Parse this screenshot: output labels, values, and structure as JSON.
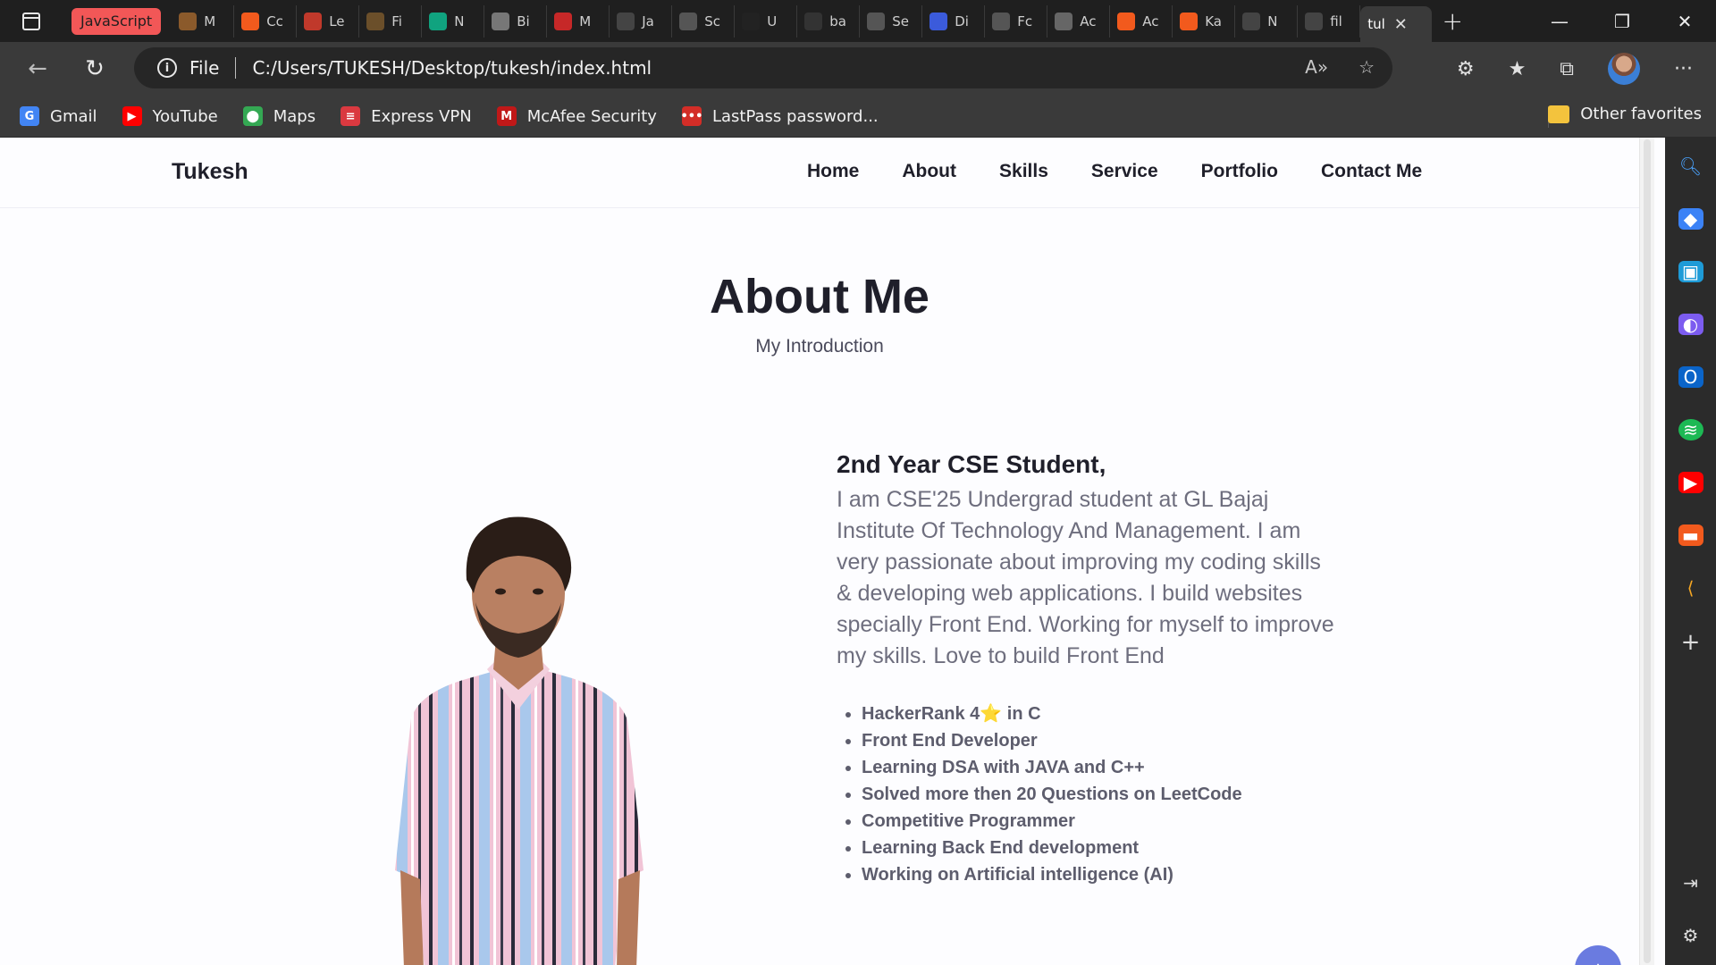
{
  "browser": {
    "group_label": "JavaScript",
    "tabs": [
      {
        "label": "M",
        "color": "#8b5a2b"
      },
      {
        "label": "Cc",
        "color": "#f25a1d"
      },
      {
        "label": "Le",
        "color": "#c0392b"
      },
      {
        "label": "Fi",
        "color": "#6b4f2a"
      },
      {
        "label": "N",
        "color": "#10a37f"
      },
      {
        "label": "Bi",
        "color": "#777777"
      },
      {
        "label": "M",
        "color": "#c62828"
      },
      {
        "label": "Ja",
        "color": "#444444"
      },
      {
        "label": "Sc",
        "color": "#555555"
      },
      {
        "label": "U",
        "color": "#222222"
      },
      {
        "label": "ba",
        "color": "#333333"
      },
      {
        "label": "Se",
        "color": "#555555"
      },
      {
        "label": "Di",
        "color": "#3b5bdb"
      },
      {
        "label": "Fc",
        "color": "#555555"
      },
      {
        "label": "Ac",
        "color": "#666666"
      },
      {
        "label": "Ac",
        "color": "#f25a1d"
      },
      {
        "label": "Ka",
        "color": "#f25a1d"
      },
      {
        "label": "N",
        "color": "#444444"
      },
      {
        "label": "fil",
        "color": "#444444"
      }
    ],
    "active_tab": "tul",
    "address": {
      "protocol": "File",
      "url": "C:/Users/TUKESH/Desktop/tukesh/index.html"
    }
  },
  "bookmarks": [
    {
      "label": "Gmail",
      "icon": "google-icon",
      "color": "#4285f4",
      "glyph": "G"
    },
    {
      "label": "YouTube",
      "icon": "youtube-icon",
      "color": "#ff0000",
      "glyph": "▶"
    },
    {
      "label": "Maps",
      "icon": "maps-icon",
      "color": "#34a853",
      "glyph": "⬤"
    },
    {
      "label": "Express VPN",
      "icon": "expressvpn-icon",
      "color": "#da3940",
      "glyph": "≡"
    },
    {
      "label": "McAfee Security",
      "icon": "mcafee-icon",
      "color": "#c01818",
      "glyph": "M"
    },
    {
      "label": "LastPass password...",
      "icon": "lastpass-icon",
      "color": "#d32d27",
      "glyph": "•••"
    }
  ],
  "other_favorites": "Other favorites",
  "site": {
    "logo": "Tukesh",
    "nav": [
      "Home",
      "About",
      "Skills",
      "Service",
      "Portfolio",
      "Contact Me"
    ],
    "section_title": "About Me",
    "section_subtitle": "My Introduction",
    "heading": "2nd Year CSE Student,",
    "description": "I am CSE'25 Undergrad student at GL Bajaj Institute Of Technology And Management. I am very passionate about improving my coding skills & developing web applications. I build websites specially Front End. Working for myself to improve my skills. Love to build Front End",
    "highlights": [
      {
        "before": "HackerRank 4",
        "star": "⭐",
        "after": " in C"
      },
      {
        "before": "Front End Developer"
      },
      {
        "before": "Learning DSA with JAVA and C++"
      },
      {
        "before": "Solved more then 20 Questions on LeetCode"
      },
      {
        "before": "Competitive Programmer"
      },
      {
        "before": "Learning Back End development"
      },
      {
        "before": "Working on Artificial intelligence (AI)"
      }
    ]
  },
  "colors": {
    "accent": "#6a7be0",
    "title": "#1f1f2a",
    "text": "#6e6e7e"
  }
}
